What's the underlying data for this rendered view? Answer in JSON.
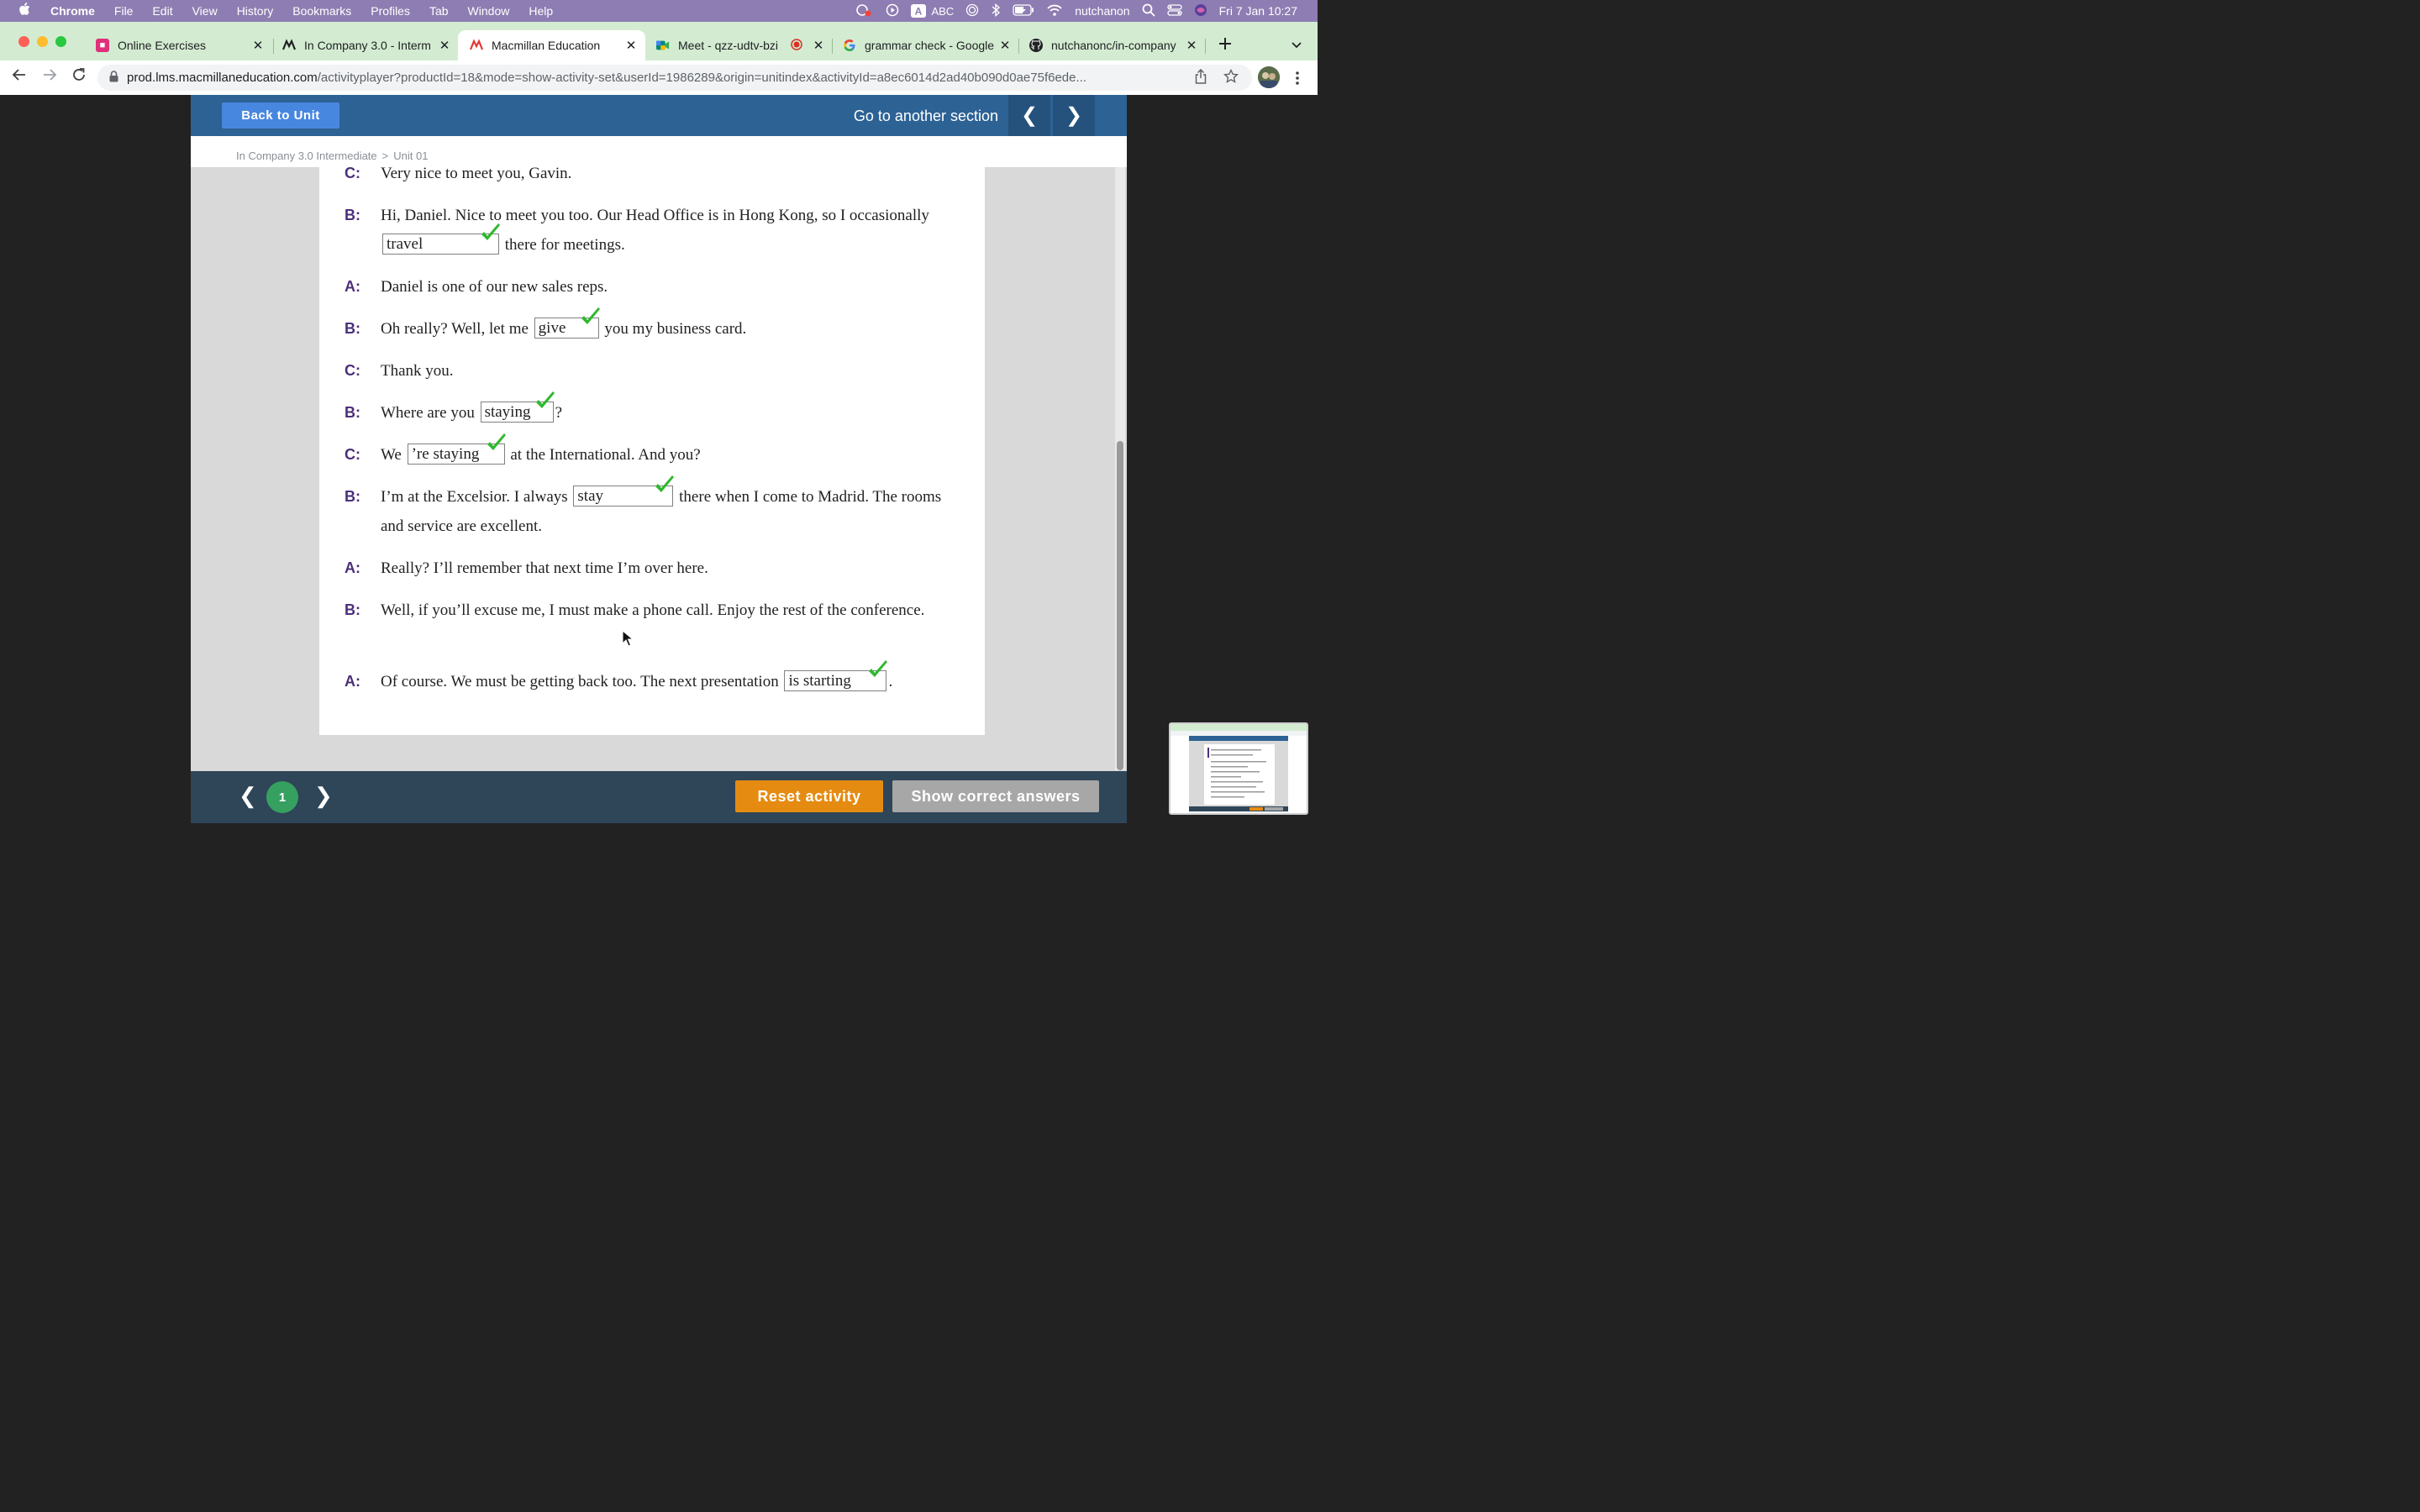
{
  "menubar": {
    "app_name": "Chrome",
    "menus": [
      "File",
      "Edit",
      "View",
      "History",
      "Bookmarks",
      "Profiles",
      "Tab",
      "Window",
      "Help"
    ],
    "input_source": "ABC",
    "user": "nutchanon",
    "clock": "Fri 7 Jan  10:27"
  },
  "tabs": [
    {
      "title": "Online Exercises",
      "icon": "online-exercises-icon",
      "color": "#e0307a"
    },
    {
      "title": "In Company 3.0 - Interm",
      "icon": "macmillan-icon",
      "color": "#202124"
    },
    {
      "title": "Macmillan Education",
      "icon": "macmillan-icon",
      "color": "#e53935"
    },
    {
      "title": "Meet - qzz-udtv-bzi",
      "icon": "meet-icon",
      "color": "#00897b"
    },
    {
      "title": "grammar check - Google",
      "icon": "google-icon",
      "color": "#4285f4"
    },
    {
      "title": "nutchanonc/in-company",
      "icon": "github-icon",
      "color": "#202124"
    }
  ],
  "url": {
    "host": "prod.lms.macmillaneducation.com",
    "path": "/activityplayer?productId=18&mode=show-activity-set&userId=1986289&origin=unitindex&activityId=a8ec6014d2ad40b090d0ae75f6ede..."
  },
  "header": {
    "back_label": "Back to Unit",
    "section_label": "Go to another section",
    "prev_symbol": "❮",
    "next_symbol": "❯"
  },
  "breadcrumb": {
    "course": "In Company 3.0 Intermediate",
    "separator": ">",
    "unit": "Unit 01"
  },
  "dialogue": [
    {
      "speaker": "C:",
      "t1": "Very nice to meet you, Gavin."
    },
    {
      "speaker": "B:",
      "t1": "Hi, Daniel. Nice to meet you too. Our Head Office is in Hong Kong, so I occasionally",
      "answer": "travel",
      "t2": "there for meetings."
    },
    {
      "speaker": "A:",
      "t1": "Daniel is one of our new sales reps."
    },
    {
      "speaker": "B:",
      "t1": "Oh really? Well, let me",
      "answer": "give",
      "t2": "you my business card."
    },
    {
      "speaker": "C:",
      "t1": "Thank you."
    },
    {
      "speaker": "B:",
      "t1": "Where are you",
      "answer": "staying",
      "t2": "?"
    },
    {
      "speaker": "C:",
      "t1": "We",
      "answer": "’re staying",
      "t2": "at the International. And you?"
    },
    {
      "speaker": "B:",
      "t1": "I’m at the Excelsior. I always",
      "answer": "stay",
      "t2": "there when I come to Madrid. The rooms and service are excellent."
    },
    {
      "speaker": "A:",
      "t1": "Really? I’ll remember that next time I’m over here."
    },
    {
      "speaker": "B:",
      "t1": "Well, if you’ll excuse me, I must make a phone call. Enjoy the rest of the conference."
    },
    {
      "speaker": "A:",
      "t1": "Of course. We must be getting back too. The next presentation",
      "answer": "is starting",
      "t2": "."
    }
  ],
  "footer": {
    "prev_symbol": "❮",
    "page": "1",
    "next_symbol": "❯",
    "reset_label": "Reset activity",
    "show_answers_label": "Show correct answers"
  },
  "colors": {
    "header_bg": "#2d6295",
    "accent_blue": "#4887e0",
    "reset_orange": "#e58b12",
    "page_badge_green": "#36a060",
    "speaker_purple": "#4c2f7a",
    "check_green": "#2eb82e"
  }
}
